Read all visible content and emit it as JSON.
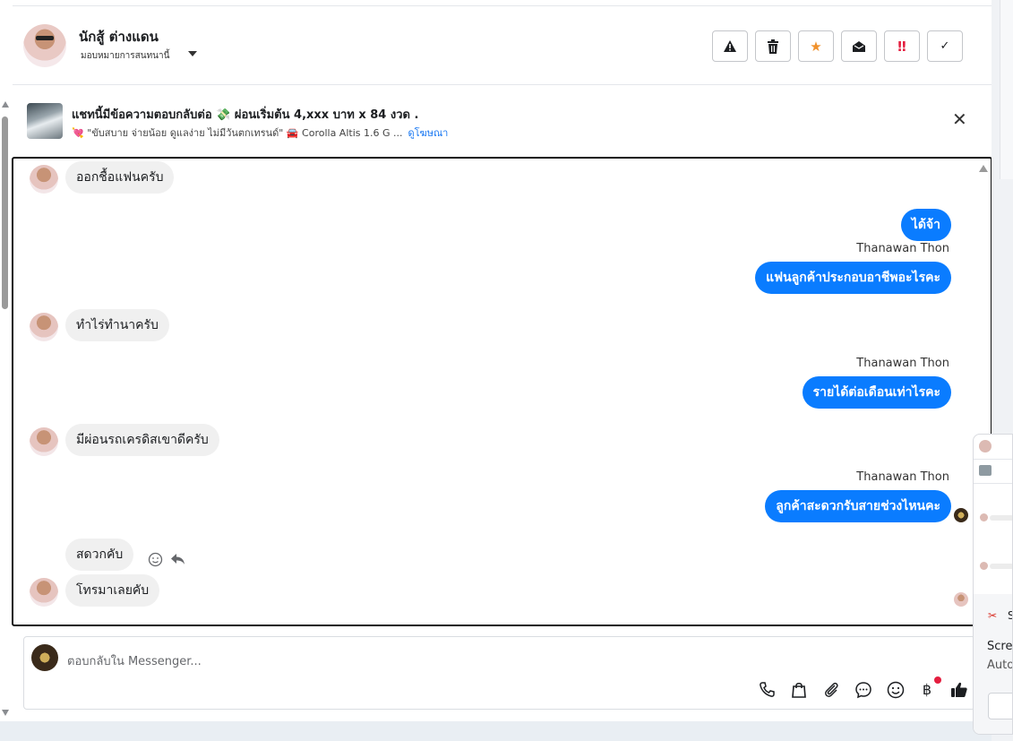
{
  "header": {
    "name": "นักสู้ ต่างแดน",
    "assign_label": "มอบหมายการสนทนานี้"
  },
  "toolbar": [
    {
      "name": "report-button",
      "icon": "warning-icon",
      "glyph": "⚠"
    },
    {
      "name": "delete-button",
      "icon": "trash-icon",
      "glyph": "🗑"
    },
    {
      "name": "star-button",
      "icon": "star-icon",
      "glyph": "★",
      "color": "#f0902a"
    },
    {
      "name": "mark-unread-button",
      "icon": "open-envelope-icon",
      "glyph": "✉"
    },
    {
      "name": "important-button",
      "icon": "double-exclamation-icon",
      "glyph": "‼",
      "color": "#e41e3f"
    },
    {
      "name": "done-button",
      "icon": "check-icon",
      "glyph": "✓"
    }
  ],
  "ad": {
    "title": "แชทนี้มีข้อความตอบกลับต่อ 💸 ผ่อนเริ่มต้น 4,xxx บาท x 84 งวด .",
    "subtitle": "💘 \"ขับสบาย จ่ายน้อย ดูแลง่าย ไม่มีวันตกเทรนด์\" 🚘 Corolla Altis 1.6 G ...",
    "link": "ดูโฆษณา",
    "close": "✕"
  },
  "messages": [
    {
      "dir": "in",
      "text": "ออกชื้อแฟนครับ"
    },
    {
      "dir": "out",
      "text": "ได้จ้า"
    },
    {
      "dir": "out",
      "sender": "Thanawan Thon",
      "text": "แฟนลูกค้าประกอบอาชีพอะไรคะ"
    },
    {
      "dir": "in",
      "text": "ทำไร่ทำนาครับ"
    },
    {
      "dir": "out",
      "sender": "Thanawan Thon",
      "text": "รายได้ต่อเดือนเท่าไรคะ"
    },
    {
      "dir": "in",
      "text": "มีผ่อนรถเครดิสเขาดีครับ"
    },
    {
      "dir": "out",
      "sender": "Thanawan Thon",
      "text": "ลูกค้าสะดวกรับสายช่วงไหนคะ"
    },
    {
      "dir": "in",
      "text": "สดวกคับ"
    },
    {
      "dir": "in",
      "text": "โทรมาเลยคับ"
    }
  ],
  "composer": {
    "placeholder": "ตอบกลับใน Messenger...",
    "icons": [
      "phone-icon",
      "shopping-bag-icon",
      "paperclip-icon",
      "saved-reply-icon",
      "emoji-icon",
      "baht-icon",
      "thumbs-up-icon"
    ]
  },
  "popup": {
    "label1": "Scree",
    "label2": "Auto",
    "s_label": "S"
  },
  "colors": {
    "outgoing_bubble": "#0a7cff",
    "incoming_bubble": "#f0f0f0",
    "link": "#1877f2"
  }
}
